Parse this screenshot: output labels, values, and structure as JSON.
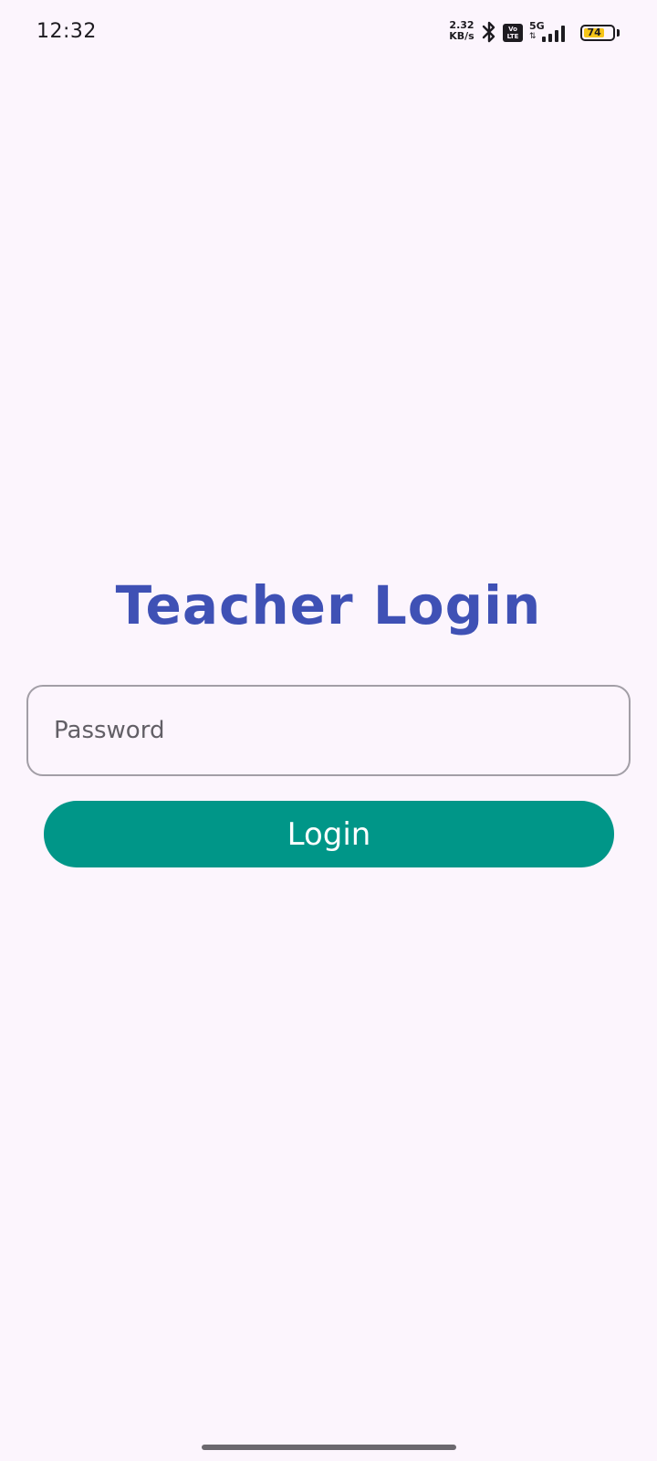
{
  "status_bar": {
    "time": "12:32",
    "net_speed_value": "2.32",
    "net_speed_unit": "KB/s",
    "volte_top": "Vo",
    "volte_bottom": "LTE",
    "network_type": "5G",
    "battery_level": "74",
    "battery_fraction": 0.74,
    "icons": [
      "bluetooth-icon",
      "volte-icon",
      "signal-icon",
      "battery-icon"
    ]
  },
  "login": {
    "title": "Teacher Login",
    "password_placeholder": "Password",
    "password_value": "",
    "button_label": "Login"
  },
  "colors": {
    "background": "#fcf5fd",
    "title": "#3f51b5",
    "button": "#009688",
    "button_text": "#ffffff",
    "field_border": "#a29ea6",
    "battery_fill": "#f5c518"
  }
}
